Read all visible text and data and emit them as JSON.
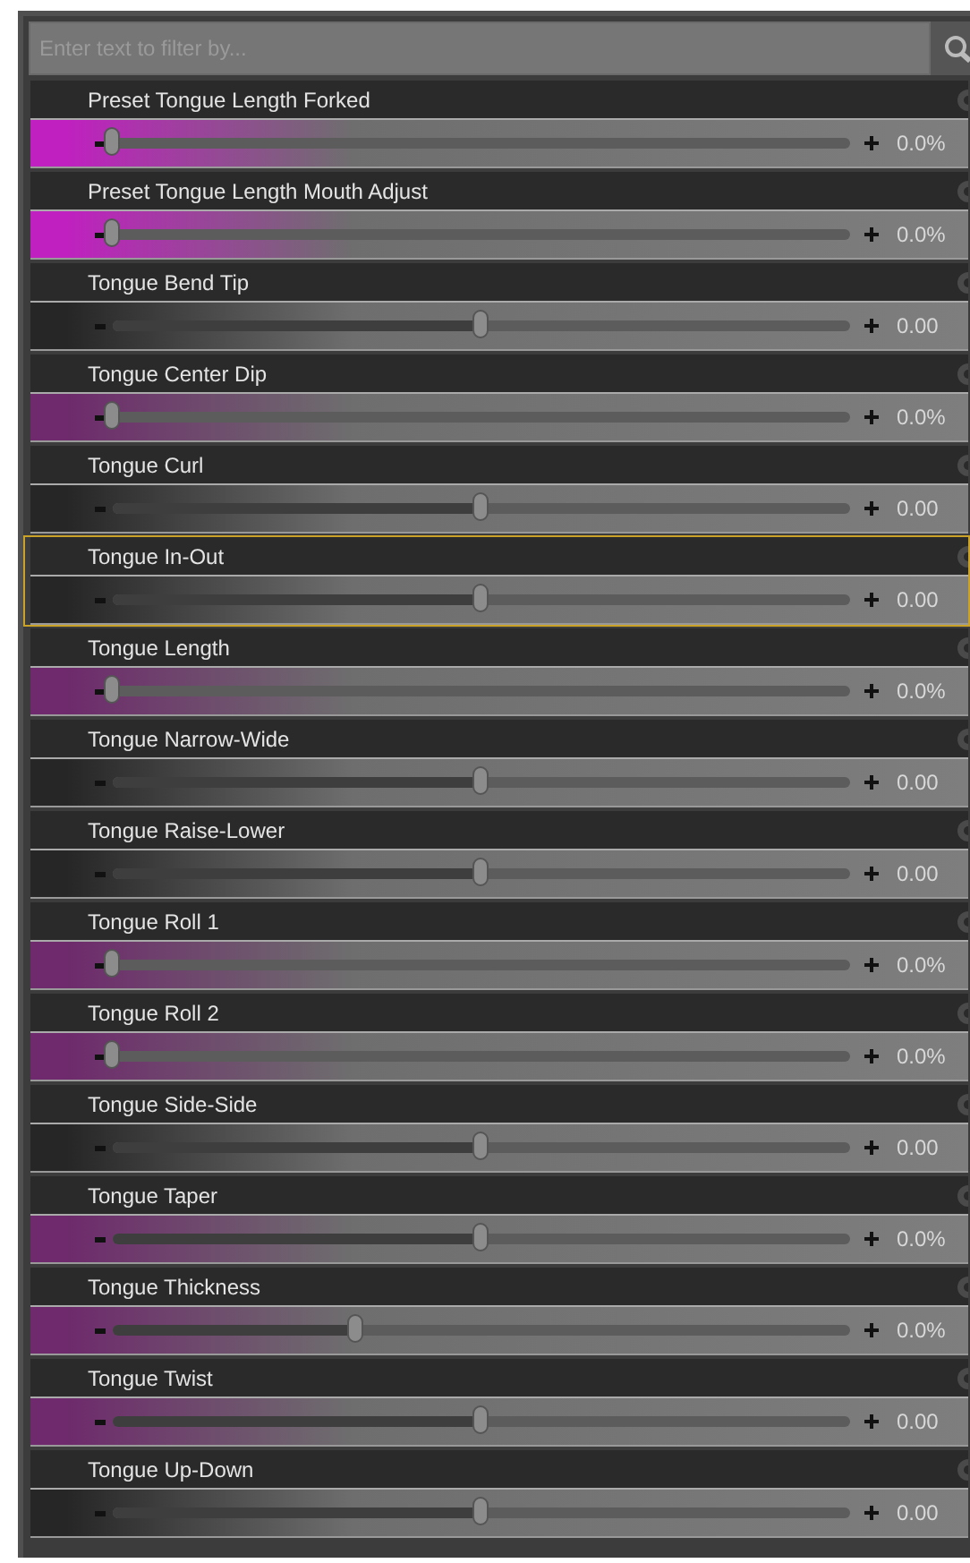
{
  "search": {
    "placeholder": "Enter text to filter by..."
  },
  "properties": [
    {
      "label": "Preset Tongue Length Forked",
      "kind": "strong",
      "level": 0,
      "value": "0.0%",
      "selected": false
    },
    {
      "label": "Preset Tongue Length Mouth Adjust",
      "kind": "strong",
      "level": 0,
      "value": "0.0%",
      "selected": false
    },
    {
      "label": "Tongue Bend Tip",
      "kind": "none",
      "level": 0.5,
      "value": "0.00",
      "selected": false
    },
    {
      "label": "Tongue Center Dip",
      "kind": "soft",
      "level": 0,
      "value": "0.0%",
      "selected": false
    },
    {
      "label": "Tongue Curl",
      "kind": "none",
      "level": 0.5,
      "value": "0.00",
      "selected": false
    },
    {
      "label": "Tongue In-Out",
      "kind": "none",
      "level": 0.5,
      "value": "0.00",
      "selected": true
    },
    {
      "label": "Tongue Length",
      "kind": "soft",
      "level": 0,
      "value": "0.0%",
      "selected": false
    },
    {
      "label": "Tongue Narrow-Wide",
      "kind": "none",
      "level": 0.5,
      "value": "0.00",
      "selected": false
    },
    {
      "label": "Tongue Raise-Lower",
      "kind": "none",
      "level": 0.5,
      "value": "0.00",
      "selected": false
    },
    {
      "label": "Tongue Roll 1",
      "kind": "soft",
      "level": 0,
      "value": "0.0%",
      "selected": false
    },
    {
      "label": "Tongue Roll 2",
      "kind": "soft",
      "level": 0,
      "value": "0.0%",
      "selected": false
    },
    {
      "label": "Tongue Side-Side",
      "kind": "none",
      "level": 0.5,
      "value": "0.00",
      "selected": false
    },
    {
      "label": "Tongue Taper",
      "kind": "soft",
      "level": 0.5,
      "value": "0.0%",
      "selected": false
    },
    {
      "label": "Tongue Thickness",
      "kind": "soft",
      "level": 0.33,
      "value": "0.0%",
      "selected": false
    },
    {
      "label": "Tongue Twist",
      "kind": "soft",
      "level": 0.5,
      "value": "0.00",
      "selected": false
    },
    {
      "label": "Tongue Up-Down",
      "kind": "none",
      "level": 0.5,
      "value": "0.00",
      "selected": false
    }
  ]
}
